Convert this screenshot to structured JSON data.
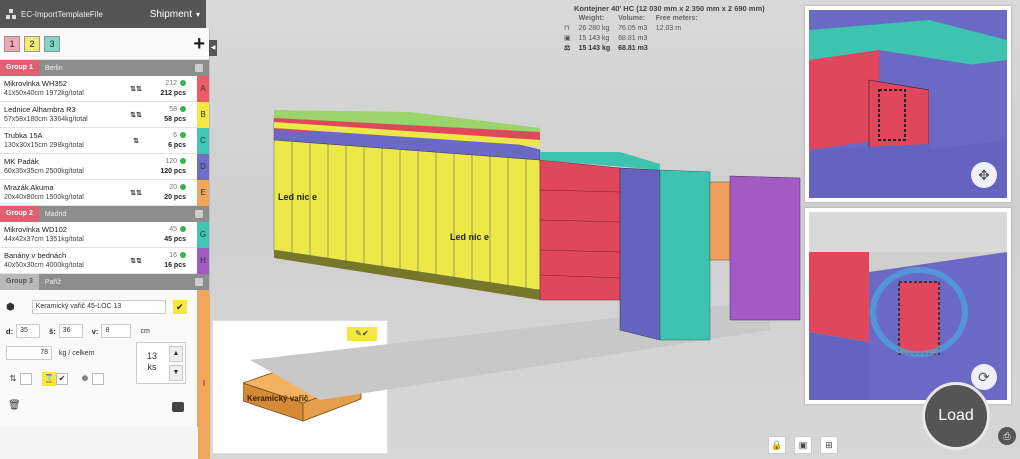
{
  "topbar": {
    "file_name": "EC-ImportTemplateFile",
    "shipment_label": "Shipment",
    "dropdown_icon": "chevron-down-icon"
  },
  "group_tabs": [
    "1",
    "2",
    "3"
  ],
  "groups": [
    {
      "name": "Group 1",
      "city": "Berlin",
      "items": [
        {
          "name": "Mikrovlnka WH352",
          "dims": "41x50x40cm 1972kg/total",
          "rotation": "⇅⇅",
          "count": "212",
          "pcs": "212 pcs",
          "letter": "A",
          "color": "#ef5a6b"
        },
        {
          "name": "Lednice Alhambra R3",
          "dims": "57x58x180cm 3364kg/total",
          "rotation": "⇅⇅",
          "count": "58",
          "pcs": "58 pcs",
          "letter": "B",
          "color": "#f5e640"
        },
        {
          "name": "Trubka 15A",
          "dims": "130x30x15cm 298kg/total",
          "rotation": "⇅",
          "count": "6",
          "pcs": "6 pcs",
          "letter": "C",
          "color": "#3fc6b4"
        },
        {
          "name": "MK Padák",
          "dims": "60x35x35cm 2500kg/total",
          "rotation": "",
          "count": "120",
          "pcs": "120 pcs",
          "letter": "D",
          "color": "#6e6ec6"
        },
        {
          "name": "Mrazák Akuma",
          "dims": "20x40x80cm 1500kg/total",
          "rotation": "⇅⇅",
          "count": "20",
          "pcs": "20 pcs",
          "letter": "E",
          "color": "#f0a75b"
        }
      ]
    },
    {
      "name": "Group 2",
      "city": "Madrid",
      "items": [
        {
          "name": "Mikrovlnka WD102",
          "dims": "44x42x37cm 1351kg/total",
          "rotation": "",
          "count": "45",
          "pcs": "45 pcs",
          "letter": "G",
          "color": "#3fc6b4"
        },
        {
          "name": "Banány v bednách",
          "dims": "40x50x30cm 4000kg/total",
          "rotation": "⇅⇅",
          "count": "16",
          "pcs": "16 pcs",
          "letter": "H",
          "color": "#a259c2"
        }
      ]
    },
    {
      "name": "Group 3",
      "city": "Paříž",
      "editor": {
        "item_name": "Keramický vařič 45-LOC 13",
        "d_label": "d:",
        "d_value": "35",
        "s_label": "š:",
        "s_value": "36",
        "v_label": "v:",
        "v_value": "8",
        "unit_cm": "cm",
        "weight_value": "78",
        "weight_unit": "kg / celkem",
        "qty_value": "13",
        "qty_unit": "ks",
        "letter": "I"
      }
    }
  ],
  "preview": {
    "box_label": "Keramický vařič"
  },
  "stats": {
    "title": "Kontejner 40' HC (12 030 mm x 2 350 mm x 2 690 mm)",
    "headers": [
      "Weight:",
      "Volume:",
      "Free meters:"
    ],
    "rows": [
      [
        "26 280 kg",
        "76.05 m3",
        "12.03 m"
      ],
      [
        "15 143 kg",
        "68.81 m3",
        ""
      ],
      [
        "15 143 kg",
        "68.81 m3",
        ""
      ]
    ]
  },
  "scene_labels": {
    "fridge_text": "Led nic e"
  },
  "views": {
    "pan_icon": "move-arrows-icon",
    "rotate_icon": "rotate-icon"
  },
  "load_button": "Load"
}
